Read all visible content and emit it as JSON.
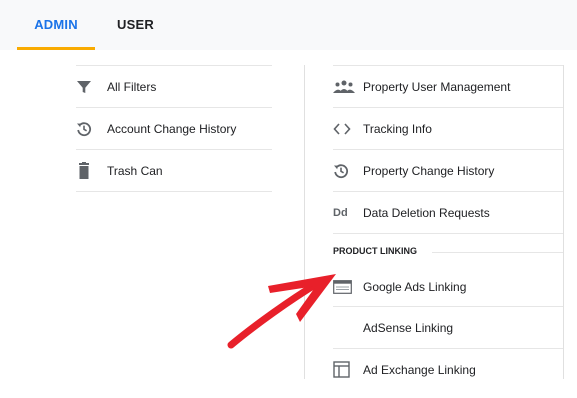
{
  "tabs": {
    "admin": "ADMIN",
    "user": "USER"
  },
  "account_column": {
    "items": [
      {
        "label": "All Filters",
        "icon": "filter-icon"
      },
      {
        "label": "Account Change History",
        "icon": "history-icon"
      },
      {
        "label": "Trash Can",
        "icon": "trash-icon"
      }
    ]
  },
  "property_column": {
    "items": [
      {
        "label": "Property User Management",
        "icon": "people-icon"
      },
      {
        "label": "Tracking Info",
        "icon": "code-icon"
      },
      {
        "label": "Property Change History",
        "icon": "history-icon"
      },
      {
        "label": "Data Deletion Requests",
        "icon": "dd-icon",
        "icon_text": "Dd"
      }
    ],
    "section_title": "PRODUCT LINKING",
    "linking_items": [
      {
        "label": "Google Ads Linking",
        "icon": "google-ads-icon"
      },
      {
        "label": "AdSense Linking",
        "icon": ""
      },
      {
        "label": "Ad Exchange Linking",
        "icon": "ad-exchange-icon"
      }
    ]
  },
  "colors": {
    "accent": "#1a73e8",
    "tab_underline": "#f9ab00",
    "annotation_arrow": "#e8202a"
  }
}
